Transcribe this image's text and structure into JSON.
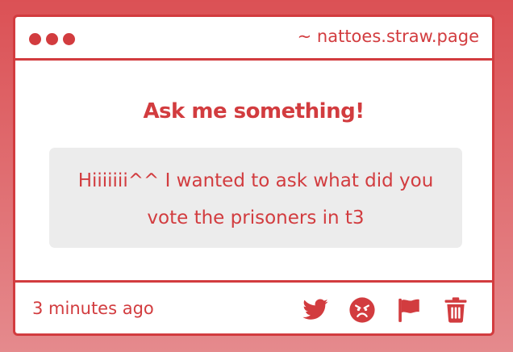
{
  "window": {
    "url": "~ nattoes.straw.page"
  },
  "card": {
    "heading": "Ask me something!",
    "question": "Hiiiiiii^^ I wanted to ask what did you vote the prisoners in t3"
  },
  "footer": {
    "timestamp": "3 minutes ago",
    "icons": [
      "twitter-icon",
      "angry-face-icon",
      "flag-icon",
      "trash-icon"
    ]
  },
  "colors": {
    "accent": "#d23c3f",
    "background_top": "#db5155",
    "background_bottom": "#e58a8d",
    "question_bg": "#ececec"
  }
}
